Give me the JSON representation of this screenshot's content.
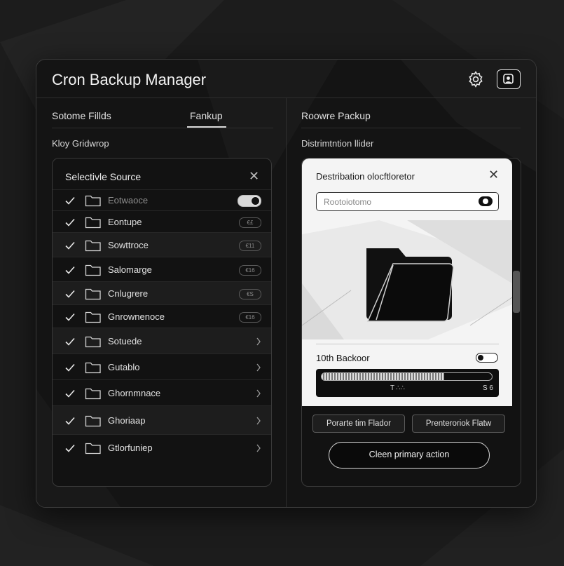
{
  "window": {
    "title": "Cron Backup Manager"
  },
  "left": {
    "tabs": [
      {
        "label": "Sotome Fillds"
      },
      {
        "label": "Fankup"
      }
    ],
    "section_label": "Kloy Gridwrop",
    "panel_title": "Selectivle Source",
    "rows": [
      {
        "label": "Eotwaoce",
        "badge": ""
      },
      {
        "label": "Eontupe",
        "badge": "€£"
      },
      {
        "label": "Sowttroce",
        "badge": "€11"
      },
      {
        "label": "Salomarge",
        "badge": "€16"
      },
      {
        "label": "Cnlugrere",
        "badge": "€S"
      },
      {
        "label": "Gnrownenoce",
        "badge": "€16"
      },
      {
        "label": "Sotuede",
        "badge": ""
      },
      {
        "label": "Gutablo",
        "badge": ""
      },
      {
        "label": "Ghornmnace",
        "badge": ""
      },
      {
        "label": "Ghoriaap",
        "badge": ""
      },
      {
        "label": "Gtlorfuniep",
        "badge": ""
      }
    ]
  },
  "right": {
    "tab": "Roowre Packup",
    "section_label": "Distrimtntion llider",
    "dialog": {
      "title": "Destribation olocftloretor",
      "input_value": "Rootoiotomo",
      "backup_label": "10th Backoor",
      "progress": {
        "fraction": 0.72,
        "time": "T ∴∴",
        "value": "S 6"
      }
    },
    "secondary_buttons": [
      "Porarte tim Flador",
      "Prenteroriok Flatw"
    ],
    "primary_button": "Cleen primary action"
  },
  "colors": {
    "background": "#1c1c1c",
    "panel": "#121212",
    "dialog": "#f4f4f4",
    "accent": "#e8e8e8"
  },
  "icons": [
    "gear-icon",
    "user-icon",
    "close-icon",
    "checkmark-icon",
    "folder-icon",
    "chevron-right-icon",
    "toggle-icon"
  ]
}
